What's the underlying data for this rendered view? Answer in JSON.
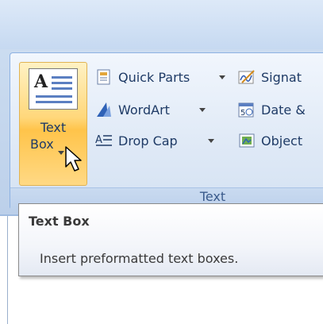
{
  "ribbon": {
    "group_label": "Text",
    "big_button": {
      "label_line1": "Text",
      "label_line2": "Box",
      "icon": "text-box-icon"
    },
    "rows": [
      {
        "label": "Quick Parts",
        "icon": "quick-parts-icon"
      },
      {
        "label": "WordArt",
        "icon": "wordart-icon"
      },
      {
        "label": "Drop Cap",
        "icon": "drop-cap-icon"
      }
    ],
    "rows_right": [
      {
        "label": "Signat",
        "icon": "signature-line-icon"
      },
      {
        "label": "Date &",
        "icon": "date-time-icon"
      },
      {
        "label": "Object",
        "icon": "object-icon"
      }
    ]
  },
  "tooltip": {
    "title": "Text Box",
    "description": "Insert preformatted text boxes."
  },
  "colors": {
    "highlight": "#ffd77a",
    "ribbon": "#cbdcf0",
    "label_text": "#1f3b66"
  }
}
